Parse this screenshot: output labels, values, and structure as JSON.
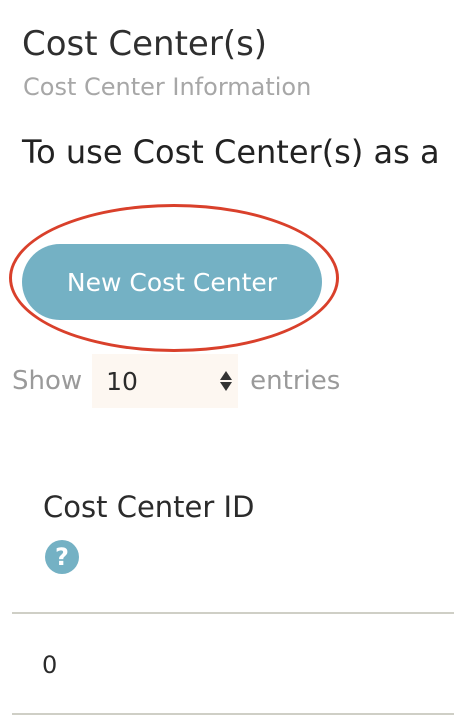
{
  "header": {
    "title": "Cost Center(s)",
    "subtitle": "Cost Center Information"
  },
  "intro_text": "To use Cost Center(s) as a",
  "actions": {
    "new_button_label": "New Cost Center"
  },
  "colors": {
    "accent": "#74b1c4",
    "highlight_ring": "#d9402b",
    "muted_text": "#9a9a9a",
    "select_bg": "#fdf7f1"
  },
  "length_menu": {
    "show_label": "Show",
    "selected_value": "10",
    "entries_label": "entries"
  },
  "table": {
    "columns": [
      {
        "label": "Cost Center ID",
        "help_icon": "question-circle-icon"
      }
    ],
    "rows": [
      {
        "cost_center_id": "0"
      }
    ]
  }
}
